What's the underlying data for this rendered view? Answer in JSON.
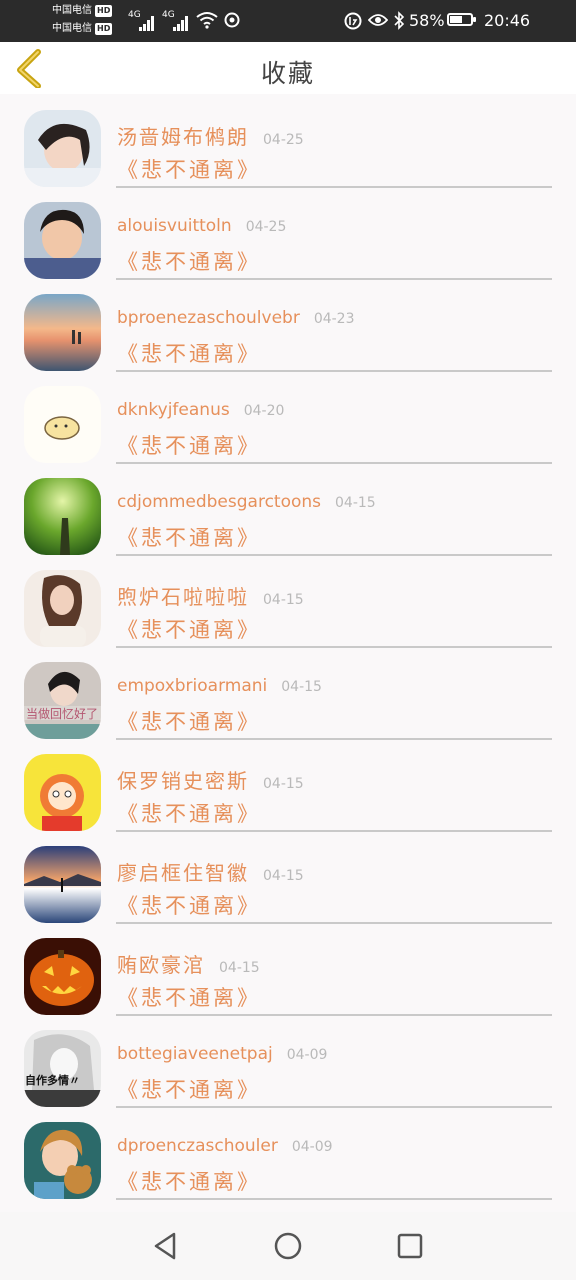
{
  "status_bar": {
    "carrier_1": "中国电信",
    "carrier_2": "中国电信",
    "hd_label": "HD",
    "network_1": "4G",
    "network_2": "4G",
    "battery_percent": "58%",
    "battery_level": 0.58,
    "time": "20:46"
  },
  "header": {
    "title": "收藏"
  },
  "list": [
    {
      "name": "汤啬姆布鸺朗",
      "date": "04-25",
      "title": "《悲不通离》",
      "cjk": true,
      "avatar": "girl-lying-photo"
    },
    {
      "name": "alouisvuittoln",
      "date": "04-25",
      "title": "《悲不通离》",
      "cjk": false,
      "avatar": "boy-photo"
    },
    {
      "name": "bproenezaschoulvebr",
      "date": "04-23",
      "title": "《悲不通离》",
      "cjk": false,
      "avatar": "beach-sunset-couple"
    },
    {
      "name": "dknkyjfeanus",
      "date": "04-20",
      "title": "《悲不通离》",
      "cjk": false,
      "avatar": "cartoon-chick"
    },
    {
      "name": "cdjommedbesgarctoons",
      "date": "04-15",
      "title": "《悲不通离》",
      "cjk": false,
      "avatar": "green-forest"
    },
    {
      "name": "煦炉石啦啦啦",
      "date": "04-15",
      "title": "《悲不通离》",
      "cjk": true,
      "avatar": "girl-sitting-photo"
    },
    {
      "name": "empoxbrioarmani",
      "date": "04-15",
      "title": "《悲不通离》",
      "cjk": false,
      "avatar": "girl-with-text"
    },
    {
      "name": "保罗销史密斯",
      "date": "04-15",
      "title": "《悲不通离》",
      "cjk": true,
      "avatar": "cartoon-girl-yellow"
    },
    {
      "name": "廖启框住智徽",
      "date": "04-15",
      "title": "《悲不通离》",
      "cjk": true,
      "avatar": "lake-silhouette"
    },
    {
      "name": "贿欧豪涫",
      "date": "04-15",
      "title": "《悲不通离》",
      "cjk": true,
      "avatar": "jack-o-lantern"
    },
    {
      "name": "bottegiaveenetpaj",
      "date": "04-09",
      "title": "《悲不通离》",
      "cjk": false,
      "avatar": "anime-girl-bw"
    },
    {
      "name": "dproenczaschouler",
      "date": "04-09",
      "title": "《悲不通离》",
      "cjk": false,
      "avatar": "child-with-teddy"
    }
  ],
  "avatar_text": {
    "girl_with_text": "当做回忆好了",
    "anime_girl_bw": "自作多情〃"
  },
  "nav_bar": {
    "back_icon": "triangle-back-icon",
    "home_icon": "circle-home-icon",
    "recents_icon": "square-recents-icon"
  },
  "colors": {
    "accent": "#e6905b",
    "date_gray": "#b9b9b9",
    "divider": "#c9c9c9",
    "back_arrow": "#c8a411",
    "status_bar_bg": "#2b2b2b"
  }
}
